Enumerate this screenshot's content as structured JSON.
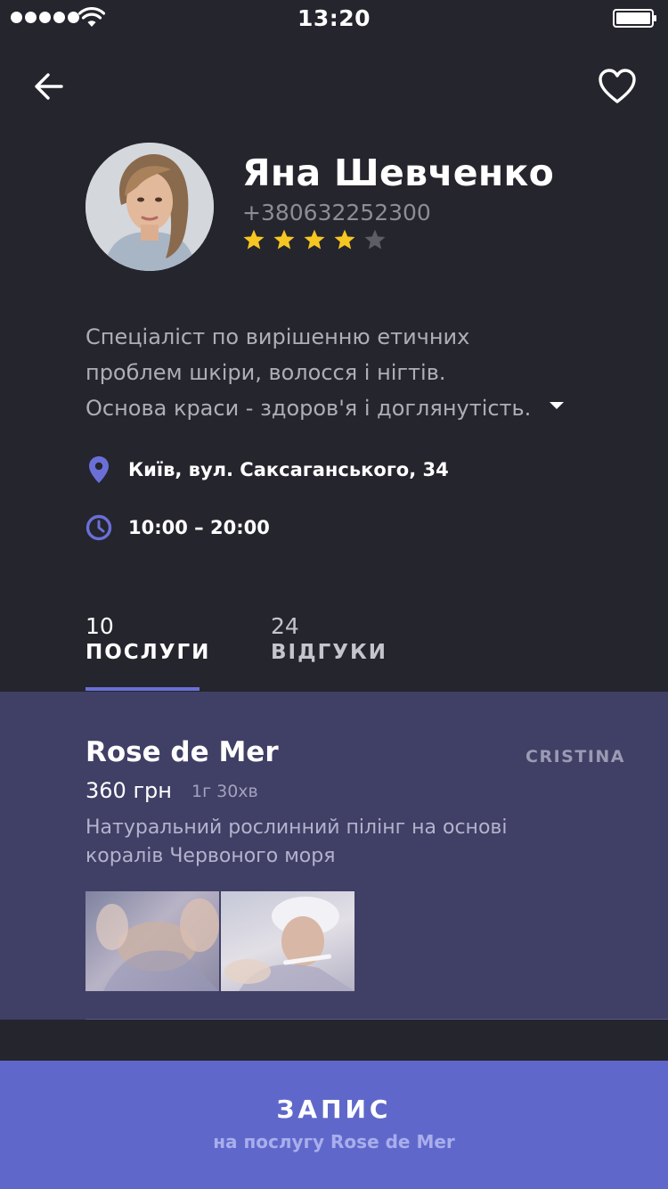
{
  "status_bar": {
    "time": "13:20"
  },
  "profile": {
    "name": "Яна Шевченко",
    "phone": "+380632252300",
    "rating": 4,
    "rating_max": 5,
    "star_color": "#f6c623",
    "description_lines": [
      "Спеціаліст по вирішенню етичних",
      "проблем шкіри, волосся і нігтів.",
      "Основа краси - здоров'я і доглянутість."
    ],
    "address": "Київ, вул. Саксаганського, 34",
    "hours": "10:00 – 20:00"
  },
  "tabs": [
    {
      "count": "10",
      "label": "ПОСЛУГИ",
      "active": true
    },
    {
      "count": "24",
      "label": "ВІДГУКИ",
      "active": false
    }
  ],
  "service": {
    "title": "Rose de Mer",
    "master": "CRISTINA",
    "price": "360 грн",
    "duration": "1г 30хв",
    "description_lines": [
      "Натуральний рослинний пілінг на основі",
      "коралів Червоного моря"
    ]
  },
  "cta": {
    "title": "ЗАПИС",
    "subtitle": "на послугу Rose de Mer"
  },
  "colors": {
    "background": "#25252d",
    "accent": "#5f68ca",
    "card": "#403f66",
    "icon_accent": "#6a6fd8"
  },
  "icons": [
    "back-arrow-icon",
    "heart-icon",
    "location-pin-icon",
    "clock-icon",
    "chevron-down-icon",
    "star-icon",
    "wifi-icon",
    "battery-icon"
  ]
}
